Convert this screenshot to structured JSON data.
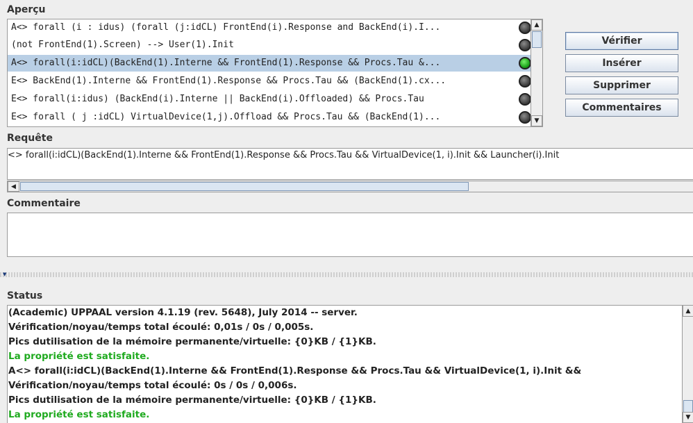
{
  "apercu": {
    "title": "Aperçu",
    "queries": [
      {
        "text": "A<>  forall (i : idus) (forall (j:idCL) FrontEnd(i).Response and BackEnd(i).I...",
        "status_color": "#444444",
        "selected": false
      },
      {
        "text": "(not FrontEnd(1).Screen) --> User(1).Init",
        "status_color": "#444444",
        "selected": false
      },
      {
        "text": "A<>  forall(i:idCL)(BackEnd(1).Interne && FrontEnd(1).Response && Procs.Tau &...",
        "status_color": "#18a018",
        "selected": true
      },
      {
        "text": "E<> BackEnd(1).Interne && FrontEnd(1).Response && Procs.Tau && (BackEnd(1).cx...",
        "status_color": "#444444",
        "selected": false
      },
      {
        "text": "E<> forall(i:idus) (BackEnd(i).Interne || BackEnd(i).Offloaded) && Procs.Tau",
        "status_color": "#444444",
        "selected": false
      },
      {
        "text": "E<> forall ( j :idCL) VirtualDevice(1,j).Offload && Procs.Tau &&  (BackEnd(1)...",
        "status_color": "#444444",
        "selected": false
      }
    ]
  },
  "buttons": {
    "verify": "Vérifier",
    "insert": "Insérer",
    "delete": "Supprimer",
    "comments": "Commentaires"
  },
  "requete": {
    "title": "Requête",
    "value": "<> forall(i:idCL)(BackEnd(1).Interne && FrontEnd(1).Response && Procs.Tau && VirtualDevice(1, i).Init && Launcher(i).Init"
  },
  "commentaire": {
    "title": "Commentaire",
    "value": ""
  },
  "status": {
    "title": "Status",
    "lines": [
      {
        "text": "(Academic) UPPAAL version 4.1.19 (rev. 5648), July 2014 -- server.",
        "ok": false
      },
      {
        "text": "Vérification/noyau/temps total écoulé: 0,01s / 0s / 0,005s.",
        "ok": false
      },
      {
        "text": "Pics dutilisation de la mémoire permanente/virtuelle: {0}KB / {1}KB.",
        "ok": false
      },
      {
        "text": "La propriété est satisfaite.",
        "ok": true
      },
      {
        "text": "A<>  forall(i:idCL)(BackEnd(1).Interne && FrontEnd(1).Response && Procs.Tau && VirtualDevice(1, i).Init &&",
        "ok": false
      },
      {
        "text": "Vérification/noyau/temps total écoulé: 0s / 0s / 0,006s.",
        "ok": false
      },
      {
        "text": "Pics dutilisation de la mémoire permanente/virtuelle: {0}KB / {1}KB.",
        "ok": false
      },
      {
        "text": "La propriété est satisfaite.",
        "ok": true
      }
    ]
  },
  "colors": {
    "selection": "#b9cfe5",
    "satisfied_text": "#1faa1f",
    "status_gray": "#444444",
    "status_green": "#18a018"
  }
}
